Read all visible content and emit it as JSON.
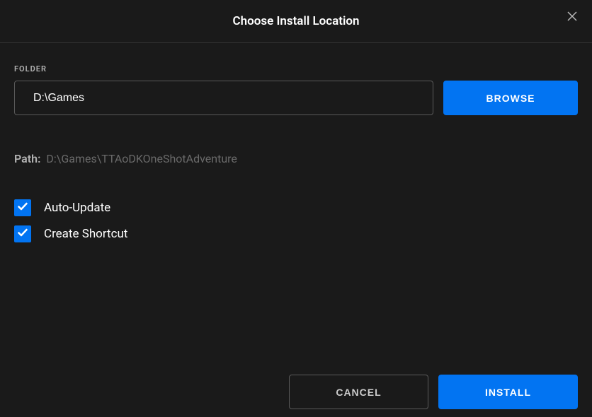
{
  "header": {
    "title": "Choose Install Location"
  },
  "folder": {
    "label": "FOLDER",
    "value": "D:\\Games",
    "browse_label": "BROWSE"
  },
  "path": {
    "label": "Path:",
    "value": "D:\\Games\\TTAoDKOneShotAdventure"
  },
  "options": {
    "auto_update": {
      "label": "Auto-Update",
      "checked": true
    },
    "create_shortcut": {
      "label": "Create Shortcut",
      "checked": true
    }
  },
  "footer": {
    "cancel_label": "CANCEL",
    "install_label": "INSTALL"
  }
}
